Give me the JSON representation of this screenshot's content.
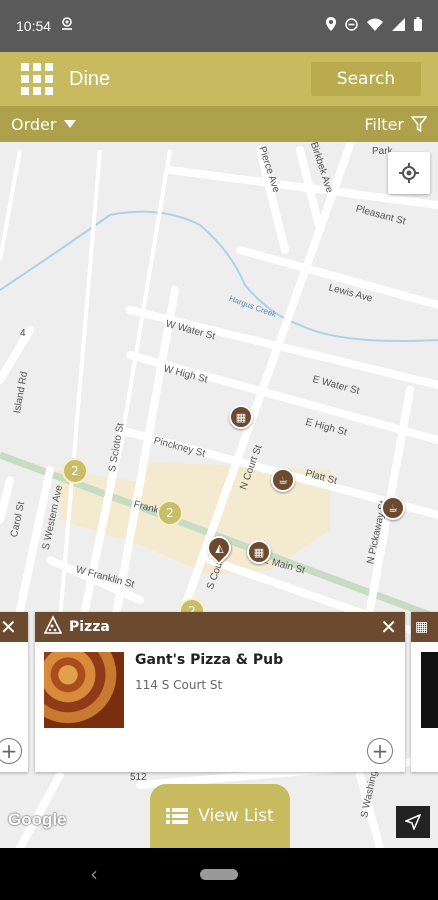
{
  "status": {
    "time": "10:54"
  },
  "header": {
    "title": "Dine",
    "search_label": "Search"
  },
  "toolbar": {
    "order_label": "Order",
    "filter_label": "Filter"
  },
  "map": {
    "streets": [
      "Park",
      "Pierce Ave",
      "Birkbek Ave",
      "Pleasant St",
      "Lewis Ave",
      "W Water St",
      "W High St",
      "E Water St",
      "E High St",
      "Pinckney St",
      "Platt St",
      "N Court St",
      "S Scioto St",
      "S Western Ave",
      "Carol St",
      "Island Rd",
      "W Franklin St",
      "Franklin St",
      "E Main St",
      "N Pickaway St",
      "S Court St",
      "S Washington",
      "Hargus Creek",
      "512",
      "4"
    ],
    "clusters": [
      "2",
      "2",
      "2"
    ],
    "google_label": "Google"
  },
  "card": {
    "category": "Pizza",
    "name": "Gant's Pizza & Pub",
    "address": "114 S Court St"
  },
  "view_list_label": "View List",
  "colors": {
    "brand": "#c8bb5f",
    "brand_dark": "#aea14c",
    "card_head": "#6b4a2f"
  }
}
